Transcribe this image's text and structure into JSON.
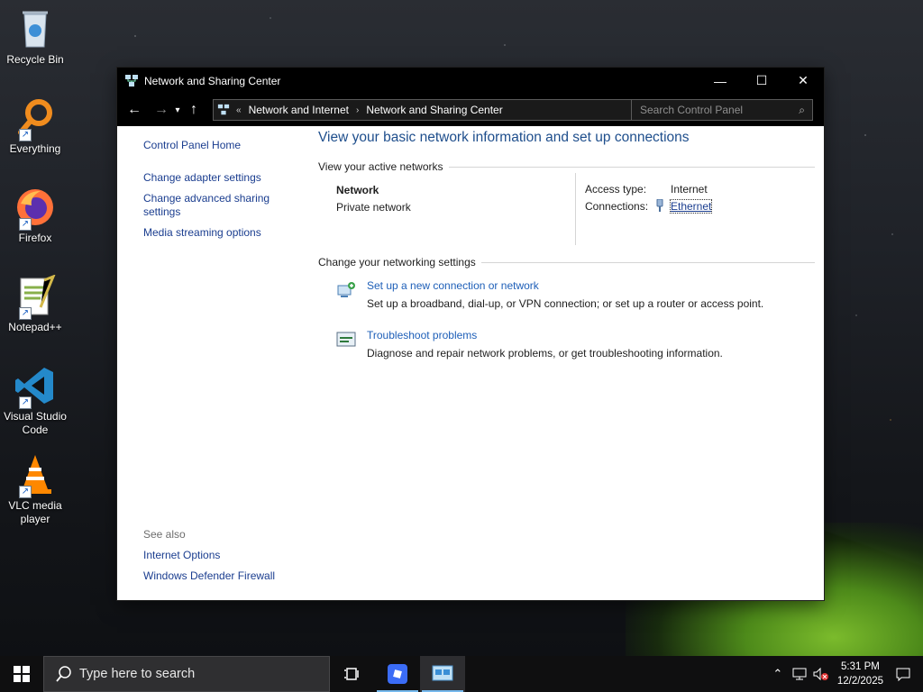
{
  "desktop": {
    "icons": [
      {
        "label": "Recycle Bin",
        "icon": "recycle-bin-icon"
      },
      {
        "label": "Everything",
        "icon": "everything-search-icon"
      },
      {
        "label": "Firefox",
        "icon": "firefox-icon"
      },
      {
        "label": "Notepad++",
        "icon": "notepad-plus-plus-icon"
      },
      {
        "label": "Visual Studio Code",
        "icon": "vscode-icon"
      },
      {
        "label": "VLC media player",
        "icon": "vlc-icon"
      }
    ]
  },
  "window": {
    "title": "Network and Sharing Center",
    "controls": {
      "minimize": "—",
      "maximize": "☐",
      "close": "✕"
    },
    "address": {
      "overflow": "«",
      "crumbs": [
        "Network and Internet",
        "Network and Sharing Center"
      ],
      "separator": "›"
    },
    "search": {
      "placeholder": "Search Control Panel"
    },
    "left_pane": {
      "home": "Control Panel Home",
      "links": [
        "Change adapter settings",
        "Change advanced sharing settings",
        "Media streaming options"
      ],
      "see_also_label": "See also",
      "see_also": [
        "Internet Options",
        "Windows Defender Firewall"
      ]
    },
    "main": {
      "heading": "View your basic network information and set up connections",
      "active_networks_label": "View your active networks",
      "network": {
        "name": "Network",
        "type": "Private network",
        "access_type_label": "Access type:",
        "access_type": "Internet",
        "connections_label": "Connections:",
        "connection": "Ethernet"
      },
      "change_settings_label": "Change your networking settings",
      "tasks": [
        {
          "link": "Set up a new connection or network",
          "desc": "Set up a broadband, dial-up, or VPN connection; or set up a router or access point.",
          "icon": "new-connection-icon"
        },
        {
          "link": "Troubleshoot problems",
          "desc": "Diagnose and repair network problems, or get troubleshooting information.",
          "icon": "troubleshoot-icon"
        }
      ]
    }
  },
  "taskbar": {
    "search_placeholder": "Type here to search",
    "time": "5:31 PM",
    "date": "12/2/2025"
  },
  "colors": {
    "link": "#1a3d8f",
    "heading": "#1e4e8c",
    "accent": "#76b9ed"
  }
}
